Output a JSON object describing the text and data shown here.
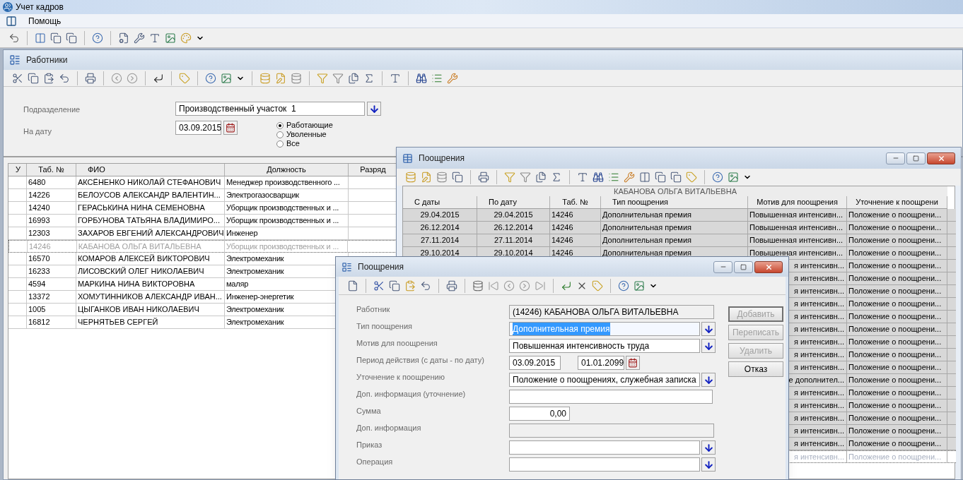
{
  "app": {
    "title": "Учет кадров",
    "menu": [
      "Помощь"
    ]
  },
  "employees_window": {
    "title": "Работники",
    "department_label": "Подразделение",
    "department_value": "Производственный участок  1",
    "date_label": "На дату",
    "date_value": "03.09.2015",
    "status_options": [
      {
        "label": "Работающие",
        "selected": true
      },
      {
        "label": "Уволенные",
        "selected": false
      },
      {
        "label": "Все",
        "selected": false
      }
    ],
    "columns": [
      "У",
      "Таб. №",
      "ФИО",
      "Должность",
      "Разряд"
    ],
    "rows": [
      {
        "tab": "6480",
        "name": "АКСЁНЕНКО НИКОЛАЙ СТЕФАНОВИЧ",
        "position": "Менеджер производственного ...",
        "selected": false
      },
      {
        "tab": "14226",
        "name": "БЕЛОУСОВ АЛЕКСАНДР ВАЛЕНТИН...",
        "position": "Электрогазосварщик",
        "selected": false
      },
      {
        "tab": "14240",
        "name": "ГЕРАСЬКИНА НИНА СЕМЕНОВНА",
        "position": "Уборщик производственных и ...",
        "selected": false
      },
      {
        "tab": "16993",
        "name": "ГОРБУНОВА ТАТЬЯНА ВЛАДИМИРО...",
        "position": "Уборщик производственных и ...",
        "selected": false
      },
      {
        "tab": "12303",
        "name": "ЗАХАРОВ ЕВГЕНИЙ АЛЕКСАНДРОВИЧ",
        "position": "Инженер",
        "selected": false
      },
      {
        "tab": "14246",
        "name": "КАБАНОВА ОЛЬГА ВИТАЛЬЕВНА",
        "position": "Уборщик производственных и ...",
        "selected": true
      },
      {
        "tab": "16570",
        "name": "КОМАРОВ АЛЕКСЕЙ ВИКТОРОВИЧ",
        "position": "Электромеханик",
        "selected": false
      },
      {
        "tab": "16233",
        "name": "ЛИСОВСКИЙ ОЛЕГ НИКОЛАЕВИЧ",
        "position": "Электромеханик",
        "selected": false
      },
      {
        "tab": "4594",
        "name": "МАРКИНА НИНА ВИКТОРОВНА",
        "position": "маляр",
        "selected": false
      },
      {
        "tab": "13372",
        "name": "ХОМУТИННИКОВ АЛЕКСАНДР ИВАН...",
        "position": "Инженер-энергетик",
        "selected": false
      },
      {
        "tab": "1005",
        "name": "ЦЫГАНКОВ ИВАН НИКОЛАЕВИЧ",
        "position": "Электромеханик",
        "selected": false
      },
      {
        "tab": "16812",
        "name": "ЧЕРНЯТЬЕВ СЕРГЕЙ",
        "position": "Электромеханик",
        "selected": false
      }
    ]
  },
  "awards_window": {
    "title": "Поощрения",
    "employee": "КАБАНОВА ОЛЬГА ВИТАЛЬЕВНА",
    "columns": [
      "С даты",
      "По дату",
      "Таб. №",
      "Тип поощрения",
      "Мотив для поощрения",
      "Уточнение к поощрени"
    ],
    "rows": [
      {
        "kind": "full",
        "from": "29.04.2015",
        "to": "29.04.2015",
        "tab": "14246",
        "type": "Дополнительная премия",
        "motive": "Повышенная интенсивн...",
        "clarification": "Положение о поощрени...",
        "selected": false
      },
      {
        "kind": "full",
        "from": "26.12.2014",
        "to": "26.12.2014",
        "tab": "14246",
        "type": "Дополнительная премия",
        "motive": "Повышенная интенсивн...",
        "clarification": "Положение о поощрени...",
        "selected": false
      },
      {
        "kind": "full",
        "from": "27.11.2014",
        "to": "27.11.2014",
        "tab": "14246",
        "type": "Дополнительная премия",
        "motive": "Повышенная интенсивн...",
        "clarification": "Положение о поощрени...",
        "selected": false
      },
      {
        "kind": "full",
        "from": "29.10.2014",
        "to": "29.10.2014",
        "tab": "14246",
        "type": "Дополнительная премия",
        "motive": "Повышенная интенсивн...",
        "clarification": "Положение о поощрени...",
        "selected": false
      },
      {
        "kind": "partial",
        "motive": "я интенсивн...",
        "clarification": "Положение о поощрени...",
        "selected": false
      },
      {
        "kind": "partial",
        "motive": "я интенсивн...",
        "clarification": "Положение о поощрени...",
        "selected": false
      },
      {
        "kind": "partial",
        "motive": "я интенсивн...",
        "clarification": "Положение о поощрени...",
        "selected": false
      },
      {
        "kind": "partial",
        "motive": "я интенсивн...",
        "clarification": "Положение о поощрени...",
        "selected": false
      },
      {
        "kind": "partial",
        "motive": "я интенсивн...",
        "clarification": "Положение о поощрени...",
        "selected": false
      },
      {
        "kind": "partial",
        "motive": "я интенсивн...",
        "clarification": "Положение о поощрени...",
        "selected": false
      },
      {
        "kind": "partial",
        "motive": "я интенсивн...",
        "clarification": "Положение о поощрени...",
        "selected": false
      },
      {
        "kind": "partial",
        "motive": "я интенсивн...",
        "clarification": "Положение о поощрени...",
        "selected": false
      },
      {
        "kind": "partial",
        "motive": "я интенсивн...",
        "clarification": "Положение о поощрени...",
        "selected": false
      },
      {
        "kind": "partial",
        "motive": "е дополнител...",
        "clarification": "Положение о поощрени...",
        "selected": false
      },
      {
        "kind": "partial",
        "motive": "я интенсивн...",
        "clarification": "Положение о поощрени...",
        "selected": false
      },
      {
        "kind": "partial",
        "motive": "я интенсивн...",
        "clarification": "Положение о поощрени...",
        "selected": false
      },
      {
        "kind": "partial",
        "motive": "я интенсивн...",
        "clarification": "Положение о поощрени...",
        "selected": false
      },
      {
        "kind": "partial",
        "motive": "я интенсивн...",
        "clarification": "Положение о поощрени...",
        "selected": false
      },
      {
        "kind": "partial",
        "motive": "я интенсивн...",
        "clarification": "Положение о поощрени...",
        "selected": false
      },
      {
        "kind": "partial",
        "motive": "я интенсивн...",
        "clarification": "Положение о поощрени...",
        "selected": true
      }
    ]
  },
  "award_dialog": {
    "title": "Поощрения",
    "fields": [
      {
        "kind": "readonly",
        "label": "Работник",
        "value": "(14246) КАБАНОВА ОЛЬГА ВИТАЛЬЕВНА"
      },
      {
        "kind": "dropdown",
        "label": "Тип поощрения",
        "value": "Дополнительная премия",
        "highlighted": true
      },
      {
        "kind": "dropdown",
        "label": "Мотив для поощрения",
        "value": "Повышенная интенсивность труда",
        "highlighted": false
      },
      {
        "kind": "period",
        "label": "Период действия (с даты - по дату)",
        "value": "03.09.2015",
        "value_to": "01.01.2099"
      },
      {
        "kind": "dropdown",
        "label": "Уточнение к поощрению",
        "value": "Положение о поощрениях, служебная записка",
        "highlighted": false
      },
      {
        "kind": "text",
        "label": "Доп. информация (уточнение)"
      },
      {
        "kind": "number",
        "label": "Сумма",
        "value": "0,00"
      },
      {
        "kind": "disabled",
        "label": "Доп. информация"
      },
      {
        "kind": "dropdown",
        "label": "Приказ"
      },
      {
        "kind": "dropdown",
        "label": "Операция"
      }
    ],
    "buttons": [
      {
        "label": "Добавить",
        "disabled": true
      },
      {
        "label": "Переписать",
        "disabled": true
      },
      {
        "label": "Удалить",
        "disabled": true
      },
      {
        "label": "Отказ",
        "disabled": false
      }
    ]
  }
}
